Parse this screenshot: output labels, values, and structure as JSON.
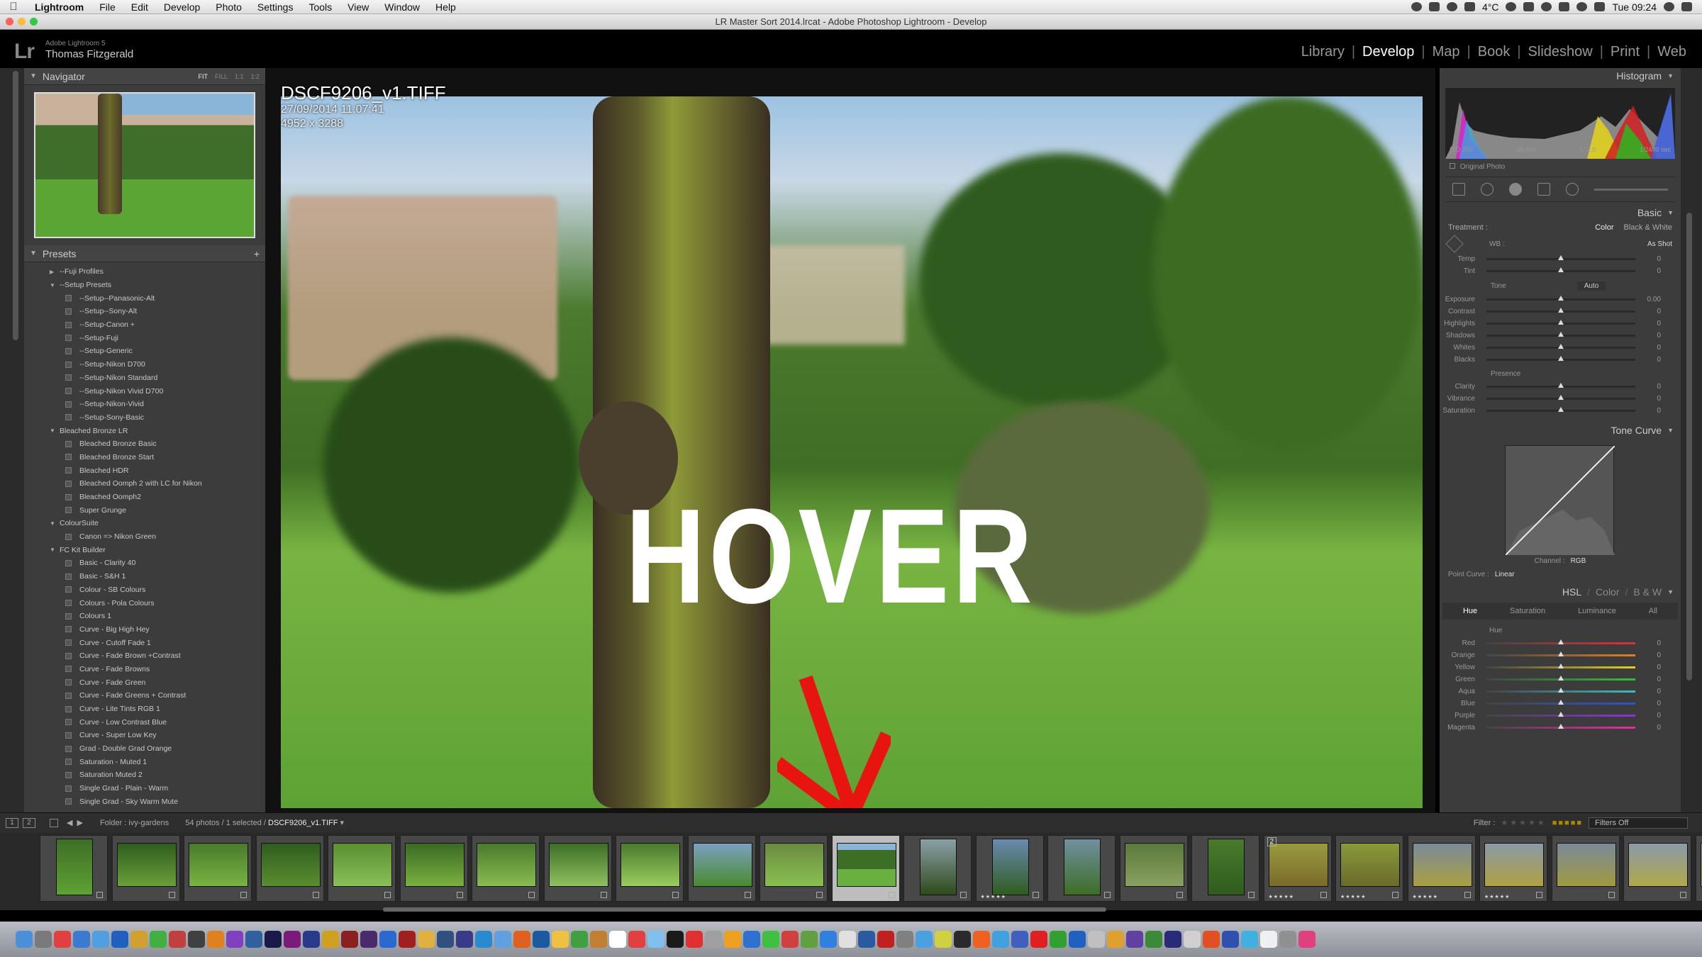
{
  "menubar": {
    "app": "Lightroom",
    "items": [
      "File",
      "Edit",
      "Develop",
      "Photo",
      "Settings",
      "Tools",
      "View",
      "Window",
      "Help"
    ],
    "temperature": "4°C",
    "clock": "Tue 09:24"
  },
  "window": {
    "title": "LR Master Sort 2014.lrcat - Adobe Photoshop Lightroom - Develop"
  },
  "identity": {
    "logo": "Lr",
    "product": "Adobe Lightroom 5",
    "user": "Thomas Fitzgerald"
  },
  "modules": [
    "Library",
    "Develop",
    "Map",
    "Book",
    "Slideshow",
    "Print",
    "Web"
  ],
  "active_module": "Develop",
  "navigator": {
    "title": "Navigator",
    "zoom_options": [
      "FIT",
      "FILL",
      "1:1",
      "1:2"
    ]
  },
  "presets": {
    "title": "Presets",
    "add": "+",
    "rows": [
      {
        "type": "folder",
        "label": "--Fuji Profiles",
        "open": false
      },
      {
        "type": "folder",
        "label": "--Setup Presets",
        "open": true
      },
      {
        "type": "item",
        "label": "--Setup--Panasonic-Alt"
      },
      {
        "type": "item",
        "label": "--Setup--Sony-Alt"
      },
      {
        "type": "item",
        "label": "--Setup-Canon +"
      },
      {
        "type": "item",
        "label": "--Setup-Fuji"
      },
      {
        "type": "item",
        "label": "--Setup-Generic"
      },
      {
        "type": "item",
        "label": "--Setup-Nikon D700"
      },
      {
        "type": "item",
        "label": "--Setup-Nikon Standard"
      },
      {
        "type": "item",
        "label": "--Setup-Nikon Vivid D700"
      },
      {
        "type": "item",
        "label": "--Setup-Nikon-Vivid"
      },
      {
        "type": "item",
        "label": "--Setup-Sony-Basic"
      },
      {
        "type": "folder",
        "label": "Bleached Bronze LR",
        "open": true
      },
      {
        "type": "item",
        "label": "Bleached Bronze Basic"
      },
      {
        "type": "item",
        "label": "Bleached Bronze Start"
      },
      {
        "type": "item",
        "label": "Bleached HDR"
      },
      {
        "type": "item",
        "label": "Bleached Oomph 2 with LC for Nikon"
      },
      {
        "type": "item",
        "label": "Bleached Oomph2"
      },
      {
        "type": "item",
        "label": "Super Grunge"
      },
      {
        "type": "folder",
        "label": "ColourSuite",
        "open": true
      },
      {
        "type": "item",
        "label": "Canon => Nikon Green"
      },
      {
        "type": "folder",
        "label": "FC Kit Builder",
        "open": true
      },
      {
        "type": "item",
        "label": "Basic - Clarity 40"
      },
      {
        "type": "item",
        "label": "Basic - S&H 1"
      },
      {
        "type": "item",
        "label": "Colour - SB Colours"
      },
      {
        "type": "item",
        "label": "Colours - Pola Colours"
      },
      {
        "type": "item",
        "label": "Colours 1"
      },
      {
        "type": "item",
        "label": "Curve - Big High Hey"
      },
      {
        "type": "item",
        "label": "Curve - Cutoff Fade 1"
      },
      {
        "type": "item",
        "label": "Curve - Fade Brown +Contrast"
      },
      {
        "type": "item",
        "label": "Curve - Fade Browns"
      },
      {
        "type": "item",
        "label": "Curve - Fade Green"
      },
      {
        "type": "item",
        "label": "Curve - Fade Greens + Contrast"
      },
      {
        "type": "item",
        "label": "Curve - Lite Tints RGB 1"
      },
      {
        "type": "item",
        "label": "Curve - Low Contrast Blue"
      },
      {
        "type": "item",
        "label": "Curve - Super Low Key"
      },
      {
        "type": "item",
        "label": "Grad - Double Grad Orange"
      },
      {
        "type": "item",
        "label": "Saturation - Muted 1"
      },
      {
        "type": "item",
        "label": "Saturation Muted 2"
      },
      {
        "type": "item",
        "label": "Single Grad - Plain - Warm"
      },
      {
        "type": "item",
        "label": "Single Grad - Sky Warm Mute"
      }
    ]
  },
  "photo": {
    "filename": "DSCF9206_v1.TIFF",
    "datetime": "27/09/2014 11:07:41",
    "dimensions": "4952 x 3288",
    "annotation": "HOVER"
  },
  "histogram": {
    "title": "Histogram",
    "iso": "ISO 200",
    "focal": "35 mm",
    "aperture": "f / 2.0",
    "shutter": "1/2400 sec",
    "original_photo": "Original Photo"
  },
  "basic": {
    "title": "Basic",
    "treatment_label": "Treatment :",
    "treatment_options": [
      "Color",
      "Black & White"
    ],
    "wb_label": "WB :",
    "wb_value": "As Shot",
    "tone_label": "Tone",
    "auto_label": "Auto",
    "presence_label": "Presence",
    "sliders_wb": [
      {
        "label": "Temp",
        "value": "0",
        "pos": 0.5
      },
      {
        "label": "Tint",
        "value": "0",
        "pos": 0.5
      }
    ],
    "sliders_tone": [
      {
        "label": "Exposure",
        "value": "0.00",
        "pos": 0.5
      },
      {
        "label": "Contrast",
        "value": "0",
        "pos": 0.5
      },
      {
        "label": "Highlights",
        "value": "0",
        "pos": 0.5
      },
      {
        "label": "Shadows",
        "value": "0",
        "pos": 0.5
      },
      {
        "label": "Whites",
        "value": "0",
        "pos": 0.5
      },
      {
        "label": "Blacks",
        "value": "0",
        "pos": 0.5
      }
    ],
    "sliders_presence": [
      {
        "label": "Clarity",
        "value": "0",
        "pos": 0.5
      },
      {
        "label": "Vibrance",
        "value": "0",
        "pos": 0.5
      },
      {
        "label": "Saturation",
        "value": "0",
        "pos": 0.5
      }
    ]
  },
  "tone_curve": {
    "title": "Tone Curve",
    "channel_label": "Channel :",
    "channel_value": "RGB",
    "point_curve_label": "Point Curve :",
    "point_curve_value": "Linear"
  },
  "hsl": {
    "title": "HSL",
    "title_color": "Color",
    "title_bw": "B & W",
    "tabs": [
      "Hue",
      "Saturation",
      "Luminance",
      "All"
    ],
    "section": "Hue",
    "sliders": [
      {
        "label": "Red",
        "value": "0",
        "pos": 0.5
      },
      {
        "label": "Orange",
        "value": "0",
        "pos": 0.5
      },
      {
        "label": "Yellow",
        "value": "0",
        "pos": 0.5
      },
      {
        "label": "Green",
        "value": "0",
        "pos": 0.5
      },
      {
        "label": "Aqua",
        "value": "0",
        "pos": 0.5
      },
      {
        "label": "Blue",
        "value": "0",
        "pos": 0.5
      },
      {
        "label": "Purple",
        "value": "0",
        "pos": 0.5
      },
      {
        "label": "Magenta",
        "value": "0",
        "pos": 0.5
      }
    ]
  },
  "filmstrip": {
    "screen1": "1",
    "screen2": "2",
    "folder_label": "Folder : ivy-gardens",
    "count_label": "54 photos / 1 selected /",
    "selected_file": "DSCF9206_v1.TIFF",
    "filter_label": "Filter :",
    "filter_value": "Filters Off",
    "stack_count": "2"
  },
  "colors": {
    "accent": "#ffffff",
    "panel_bg": "#3c3c3c",
    "annotation_arrow": "#e8140f"
  }
}
